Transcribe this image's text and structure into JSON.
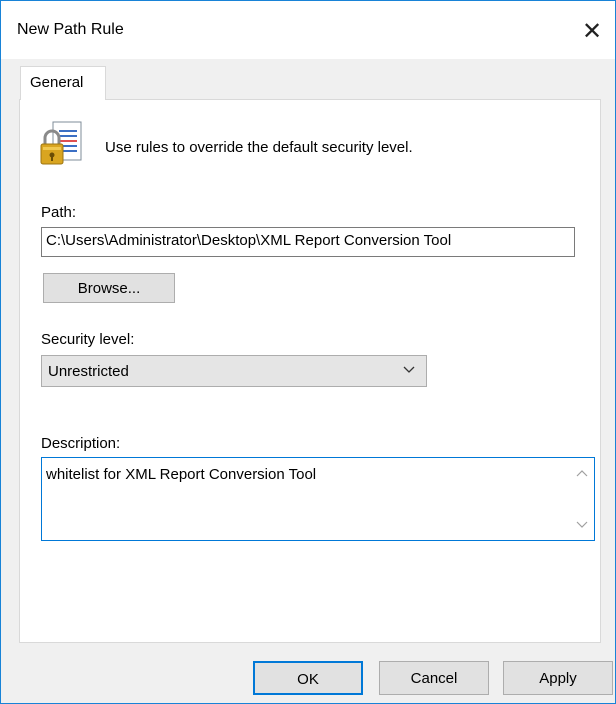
{
  "window": {
    "title": "New Path Rule",
    "close_glyph": "✕",
    "close_icon": "close-icon"
  },
  "tabs": [
    {
      "label": "General",
      "active": true
    }
  ],
  "general": {
    "icon": "lock-document-icon",
    "intro_text": "Use rules to override the default security level.",
    "path_label": "Path:",
    "path_value": "C:\\Users\\Administrator\\Desktop\\XML Report Conversion Tool",
    "browse_label": "Browse...",
    "security_label": "Security level:",
    "security_value": "Unrestricted",
    "description_label": "Description:",
    "description_value": "whitelist for XML Report Conversion Tool"
  },
  "footer": {
    "ok_label": "OK",
    "cancel_label": "Cancel",
    "apply_label": "Apply"
  },
  "colors": {
    "accent": "#0078d7",
    "window_border": "#1883d7",
    "dialog_bg": "#f0f0f0",
    "button_bg": "#e1e1e1"
  }
}
